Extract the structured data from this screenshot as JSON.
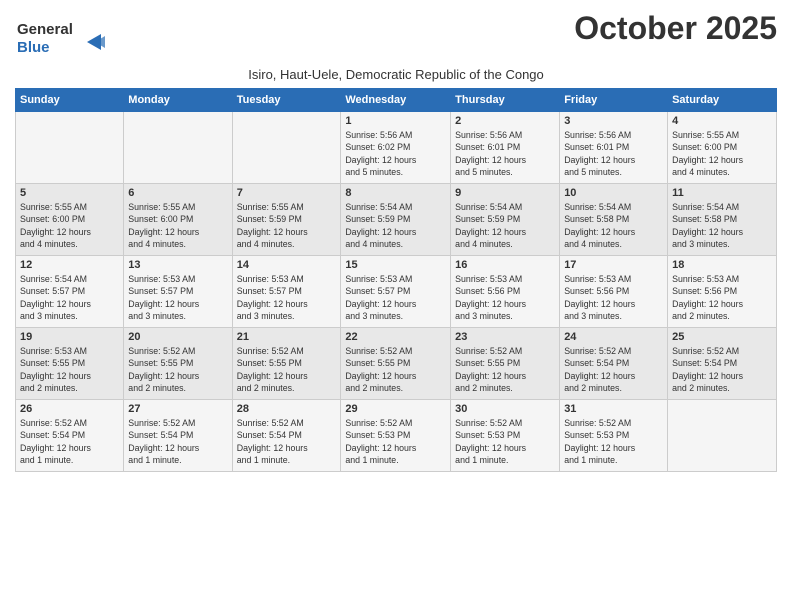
{
  "logo": {
    "line1": "General",
    "line2": "Blue"
  },
  "title": "October 2025",
  "subtitle": "Isiro, Haut-Uele, Democratic Republic of the Congo",
  "days_of_week": [
    "Sunday",
    "Monday",
    "Tuesday",
    "Wednesday",
    "Thursday",
    "Friday",
    "Saturday"
  ],
  "weeks": [
    [
      {
        "day": "",
        "info": ""
      },
      {
        "day": "",
        "info": ""
      },
      {
        "day": "",
        "info": ""
      },
      {
        "day": "1",
        "info": "Sunrise: 5:56 AM\nSunset: 6:02 PM\nDaylight: 12 hours\nand 5 minutes."
      },
      {
        "day": "2",
        "info": "Sunrise: 5:56 AM\nSunset: 6:01 PM\nDaylight: 12 hours\nand 5 minutes."
      },
      {
        "day": "3",
        "info": "Sunrise: 5:56 AM\nSunset: 6:01 PM\nDaylight: 12 hours\nand 5 minutes."
      },
      {
        "day": "4",
        "info": "Sunrise: 5:55 AM\nSunset: 6:00 PM\nDaylight: 12 hours\nand 4 minutes."
      }
    ],
    [
      {
        "day": "5",
        "info": "Sunrise: 5:55 AM\nSunset: 6:00 PM\nDaylight: 12 hours\nand 4 minutes."
      },
      {
        "day": "6",
        "info": "Sunrise: 5:55 AM\nSunset: 6:00 PM\nDaylight: 12 hours\nand 4 minutes."
      },
      {
        "day": "7",
        "info": "Sunrise: 5:55 AM\nSunset: 5:59 PM\nDaylight: 12 hours\nand 4 minutes."
      },
      {
        "day": "8",
        "info": "Sunrise: 5:54 AM\nSunset: 5:59 PM\nDaylight: 12 hours\nand 4 minutes."
      },
      {
        "day": "9",
        "info": "Sunrise: 5:54 AM\nSunset: 5:59 PM\nDaylight: 12 hours\nand 4 minutes."
      },
      {
        "day": "10",
        "info": "Sunrise: 5:54 AM\nSunset: 5:58 PM\nDaylight: 12 hours\nand 4 minutes."
      },
      {
        "day": "11",
        "info": "Sunrise: 5:54 AM\nSunset: 5:58 PM\nDaylight: 12 hours\nand 3 minutes."
      }
    ],
    [
      {
        "day": "12",
        "info": "Sunrise: 5:54 AM\nSunset: 5:57 PM\nDaylight: 12 hours\nand 3 minutes."
      },
      {
        "day": "13",
        "info": "Sunrise: 5:53 AM\nSunset: 5:57 PM\nDaylight: 12 hours\nand 3 minutes."
      },
      {
        "day": "14",
        "info": "Sunrise: 5:53 AM\nSunset: 5:57 PM\nDaylight: 12 hours\nand 3 minutes."
      },
      {
        "day": "15",
        "info": "Sunrise: 5:53 AM\nSunset: 5:57 PM\nDaylight: 12 hours\nand 3 minutes."
      },
      {
        "day": "16",
        "info": "Sunrise: 5:53 AM\nSunset: 5:56 PM\nDaylight: 12 hours\nand 3 minutes."
      },
      {
        "day": "17",
        "info": "Sunrise: 5:53 AM\nSunset: 5:56 PM\nDaylight: 12 hours\nand 3 minutes."
      },
      {
        "day": "18",
        "info": "Sunrise: 5:53 AM\nSunset: 5:56 PM\nDaylight: 12 hours\nand 2 minutes."
      }
    ],
    [
      {
        "day": "19",
        "info": "Sunrise: 5:53 AM\nSunset: 5:55 PM\nDaylight: 12 hours\nand 2 minutes."
      },
      {
        "day": "20",
        "info": "Sunrise: 5:52 AM\nSunset: 5:55 PM\nDaylight: 12 hours\nand 2 minutes."
      },
      {
        "day": "21",
        "info": "Sunrise: 5:52 AM\nSunset: 5:55 PM\nDaylight: 12 hours\nand 2 minutes."
      },
      {
        "day": "22",
        "info": "Sunrise: 5:52 AM\nSunset: 5:55 PM\nDaylight: 12 hours\nand 2 minutes."
      },
      {
        "day": "23",
        "info": "Sunrise: 5:52 AM\nSunset: 5:55 PM\nDaylight: 12 hours\nand 2 minutes."
      },
      {
        "day": "24",
        "info": "Sunrise: 5:52 AM\nSunset: 5:54 PM\nDaylight: 12 hours\nand 2 minutes."
      },
      {
        "day": "25",
        "info": "Sunrise: 5:52 AM\nSunset: 5:54 PM\nDaylight: 12 hours\nand 2 minutes."
      }
    ],
    [
      {
        "day": "26",
        "info": "Sunrise: 5:52 AM\nSunset: 5:54 PM\nDaylight: 12 hours\nand 1 minute."
      },
      {
        "day": "27",
        "info": "Sunrise: 5:52 AM\nSunset: 5:54 PM\nDaylight: 12 hours\nand 1 minute."
      },
      {
        "day": "28",
        "info": "Sunrise: 5:52 AM\nSunset: 5:54 PM\nDaylight: 12 hours\nand 1 minute."
      },
      {
        "day": "29",
        "info": "Sunrise: 5:52 AM\nSunset: 5:53 PM\nDaylight: 12 hours\nand 1 minute."
      },
      {
        "day": "30",
        "info": "Sunrise: 5:52 AM\nSunset: 5:53 PM\nDaylight: 12 hours\nand 1 minute."
      },
      {
        "day": "31",
        "info": "Sunrise: 5:52 AM\nSunset: 5:53 PM\nDaylight: 12 hours\nand 1 minute."
      },
      {
        "day": "",
        "info": ""
      }
    ]
  ]
}
